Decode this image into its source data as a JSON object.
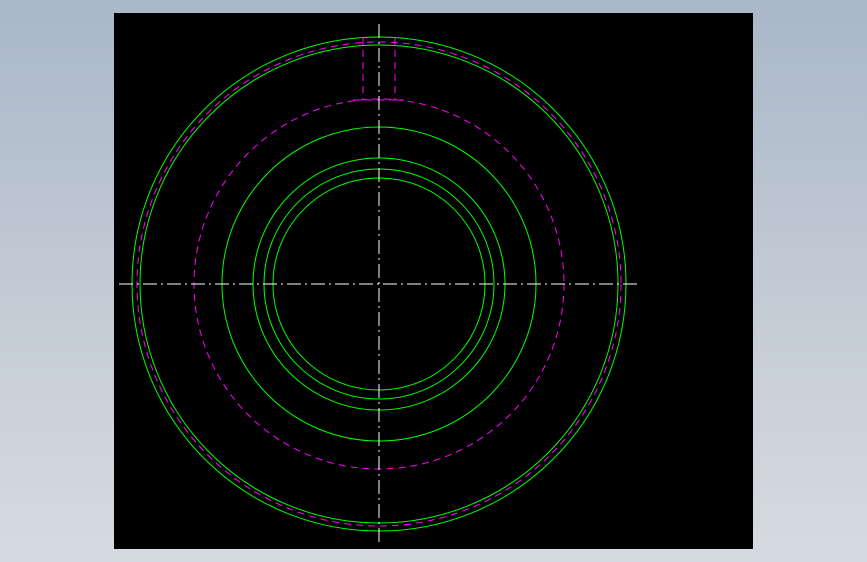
{
  "colors": {
    "background_gradient_top": "#a9b7c8",
    "background_gradient_bottom": "#d6dbe0",
    "viewport": "#000000",
    "solid_line": "#00ff00",
    "hidden_line": "#ff00ff",
    "center_line": "#ffffff"
  },
  "drawing": {
    "type": "cad-2d-front-view",
    "solid_circles": [
      "outer-rim-circle",
      "outer-rim-inner-circle",
      "hub-face-circle",
      "bore-outer-circle",
      "bore-chamfer-circle",
      "bore-circle"
    ],
    "hidden_circles": [
      "rim-hidden-circle",
      "bolt-circle-hidden"
    ],
    "hidden_lines": [
      "keyway-left-edge",
      "keyway-right-edge",
      "keyway-bottom-edge"
    ],
    "center_lines": [
      "horizontal-centerline",
      "vertical-centerline"
    ]
  }
}
